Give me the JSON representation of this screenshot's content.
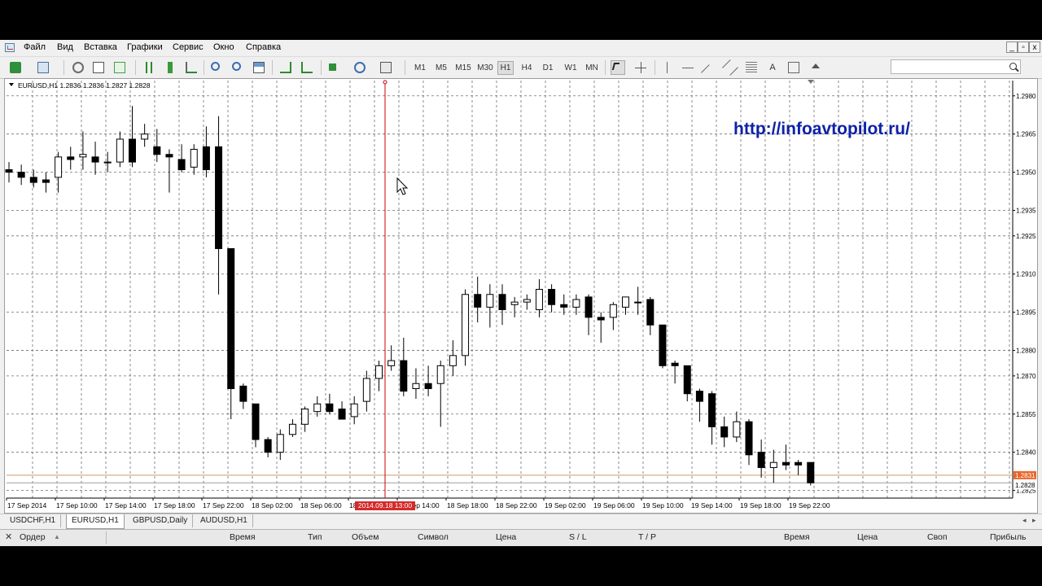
{
  "menu": {
    "items": [
      "Файл",
      "Вид",
      "Вставка",
      "Графики",
      "Сервис",
      "Окно",
      "Справка"
    ],
    "window_buttons": [
      "_",
      "▫",
      "x"
    ]
  },
  "toolbar": {
    "timeframes": [
      "M1",
      "M5",
      "M15",
      "M30",
      "H1",
      "H4",
      "D1",
      "W1",
      "MN"
    ],
    "active_timeframe": "H1",
    "search_placeholder": ""
  },
  "chart": {
    "symbol_label": "EURUSD,H1",
    "ohlc": "1.2836 1.2836 1.2827 1.2828",
    "watermark_url": "http://infoavtopilot.ru/",
    "crosshair_time_label": "2014.09.18 13:00",
    "current_price_label": "1.2831",
    "current_price_label_2": "1.2828",
    "colors": {
      "up_candle": "#ffffff",
      "down_candle": "#000000",
      "grid": "#6f6f6f",
      "watermark": "#0d21a8",
      "crosshair": "#cc0000",
      "price_line": "#d19a6a"
    }
  },
  "chart_data": {
    "type": "candlestick",
    "symbol": "EURUSD",
    "timeframe": "H1",
    "y_ticks": [
      "1.2980",
      "1.2965",
      "1.2950",
      "1.2935",
      "1.2925",
      "1.2910",
      "1.2895",
      "1.2880",
      "1.2870",
      "1.2855",
      "1.2840",
      "1.2825"
    ],
    "x_ticks": [
      "17 Sep 2014",
      "17 Sep 10:00",
      "17 Sep 14:00",
      "17 Sep 18:00",
      "17 Sep 22:00",
      "18 Sep 02:00",
      "18 Sep 06:00",
      "18 Sep 10:00",
      "18 Sep 14:00",
      "18 Sep 18:00",
      "18 Sep 22:00",
      "19 Sep 02:00",
      "19 Sep 06:00",
      "19 Sep 10:00",
      "19 Sep 14:00",
      "19 Sep 18:00",
      "19 Sep 22:00"
    ],
    "ylim": [
      1.2822,
      1.2986
    ],
    "grid": true,
    "candles": [
      {
        "o": 1.2951,
        "h": 1.2954,
        "l": 1.2946,
        "c": 1.295
      },
      {
        "o": 1.295,
        "h": 1.2953,
        "l": 1.2945,
        "c": 1.2948
      },
      {
        "o": 1.2948,
        "h": 1.2951,
        "l": 1.2944,
        "c": 1.2946
      },
      {
        "o": 1.2947,
        "h": 1.295,
        "l": 1.2942,
        "c": 1.2946
      },
      {
        "o": 1.2948,
        "h": 1.2958,
        "l": 1.2942,
        "c": 1.2956
      },
      {
        "o": 1.2956,
        "h": 1.296,
        "l": 1.2951,
        "c": 1.2955
      },
      {
        "o": 1.2956,
        "h": 1.2966,
        "l": 1.2951,
        "c": 1.2957
      },
      {
        "o": 1.2956,
        "h": 1.2962,
        "l": 1.2949,
        "c": 1.2954
      },
      {
        "o": 1.2954,
        "h": 1.2958,
        "l": 1.295,
        "c": 1.2954
      },
      {
        "o": 1.2954,
        "h": 1.2966,
        "l": 1.2952,
        "c": 1.2963
      },
      {
        "o": 1.2963,
        "h": 1.2976,
        "l": 1.2952,
        "c": 1.2954
      },
      {
        "o": 1.2963,
        "h": 1.2969,
        "l": 1.296,
        "c": 1.2965
      },
      {
        "o": 1.296,
        "h": 1.2967,
        "l": 1.2954,
        "c": 1.2957
      },
      {
        "o": 1.2957,
        "h": 1.2959,
        "l": 1.2942,
        "c": 1.2956
      },
      {
        "o": 1.2955,
        "h": 1.2961,
        "l": 1.295,
        "c": 1.2951
      },
      {
        "o": 1.2952,
        "h": 1.2961,
        "l": 1.2949,
        "c": 1.2959
      },
      {
        "o": 1.296,
        "h": 1.2968,
        "l": 1.2948,
        "c": 1.2951
      },
      {
        "o": 1.296,
        "h": 1.2972,
        "l": 1.2902,
        "c": 1.292
      },
      {
        "o": 1.292,
        "h": 1.292,
        "l": 1.2853,
        "c": 1.2865
      },
      {
        "o": 1.2866,
        "h": 1.2867,
        "l": 1.2857,
        "c": 1.286
      },
      {
        "o": 1.2859,
        "h": 1.2859,
        "l": 1.2842,
        "c": 1.2845
      },
      {
        "o": 1.2845,
        "h": 1.2846,
        "l": 1.2838,
        "c": 1.284
      },
      {
        "o": 1.284,
        "h": 1.2849,
        "l": 1.2837,
        "c": 1.2847
      },
      {
        "o": 1.2847,
        "h": 1.2853,
        "l": 1.2846,
        "c": 1.2851
      },
      {
        "o": 1.2851,
        "h": 1.2858,
        "l": 1.2848,
        "c": 1.2857
      },
      {
        "o": 1.2856,
        "h": 1.2862,
        "l": 1.2854,
        "c": 1.2859
      },
      {
        "o": 1.2859,
        "h": 1.2863,
        "l": 1.2855,
        "c": 1.2856
      },
      {
        "o": 1.2857,
        "h": 1.286,
        "l": 1.2853,
        "c": 1.2853
      },
      {
        "o": 1.2854,
        "h": 1.2862,
        "l": 1.2851,
        "c": 1.2859
      },
      {
        "o": 1.286,
        "h": 1.2872,
        "l": 1.2856,
        "c": 1.2869
      },
      {
        "o": 1.2869,
        "h": 1.2876,
        "l": 1.2864,
        "c": 1.2874
      },
      {
        "o": 1.2874,
        "h": 1.2882,
        "l": 1.2872,
        "c": 1.2876
      },
      {
        "o": 1.2876,
        "h": 1.2885,
        "l": 1.2862,
        "c": 1.2864
      },
      {
        "o": 1.2865,
        "h": 1.2873,
        "l": 1.2861,
        "c": 1.2867
      },
      {
        "o": 1.2867,
        "h": 1.2874,
        "l": 1.2862,
        "c": 1.2865
      },
      {
        "o": 1.2867,
        "h": 1.2876,
        "l": 1.285,
        "c": 1.2874
      },
      {
        "o": 1.2874,
        "h": 1.2884,
        "l": 1.287,
        "c": 1.2878
      },
      {
        "o": 1.2878,
        "h": 1.2904,
        "l": 1.2874,
        "c": 1.2902
      },
      {
        "o": 1.2902,
        "h": 1.2909,
        "l": 1.2891,
        "c": 1.2897
      },
      {
        "o": 1.2897,
        "h": 1.2906,
        "l": 1.2889,
        "c": 1.2902
      },
      {
        "o": 1.2902,
        "h": 1.2906,
        "l": 1.289,
        "c": 1.2896
      },
      {
        "o": 1.2898,
        "h": 1.2901,
        "l": 1.2893,
        "c": 1.2899
      },
      {
        "o": 1.2899,
        "h": 1.2902,
        "l": 1.2896,
        "c": 1.29
      },
      {
        "o": 1.2896,
        "h": 1.2908,
        "l": 1.2893,
        "c": 1.2904
      },
      {
        "o": 1.2904,
        "h": 1.2906,
        "l": 1.2895,
        "c": 1.2898
      },
      {
        "o": 1.2898,
        "h": 1.2902,
        "l": 1.2894,
        "c": 1.2897
      },
      {
        "o": 1.2897,
        "h": 1.2902,
        "l": 1.2894,
        "c": 1.29
      },
      {
        "o": 1.2901,
        "h": 1.2902,
        "l": 1.2886,
        "c": 1.2893
      },
      {
        "o": 1.2893,
        "h": 1.2895,
        "l": 1.2883,
        "c": 1.2892
      },
      {
        "o": 1.2893,
        "h": 1.2899,
        "l": 1.2888,
        "c": 1.2898
      },
      {
        "o": 1.2897,
        "h": 1.2901,
        "l": 1.2894,
        "c": 1.2901
      },
      {
        "o": 1.2899,
        "h": 1.2905,
        "l": 1.2894,
        "c": 1.2899
      },
      {
        "o": 1.29,
        "h": 1.2901,
        "l": 1.2886,
        "c": 1.289
      },
      {
        "o": 1.289,
        "h": 1.289,
        "l": 1.2873,
        "c": 1.2874
      },
      {
        "o": 1.2875,
        "h": 1.2876,
        "l": 1.2867,
        "c": 1.2874
      },
      {
        "o": 1.2874,
        "h": 1.2874,
        "l": 1.286,
        "c": 1.2863
      },
      {
        "o": 1.2864,
        "h": 1.2865,
        "l": 1.2852,
        "c": 1.286
      },
      {
        "o": 1.2863,
        "h": 1.2864,
        "l": 1.2843,
        "c": 1.285
      },
      {
        "o": 1.285,
        "h": 1.2854,
        "l": 1.2842,
        "c": 1.2846
      },
      {
        "o": 1.2846,
        "h": 1.2856,
        "l": 1.2844,
        "c": 1.2852
      },
      {
        "o": 1.2852,
        "h": 1.2853,
        "l": 1.2835,
        "c": 1.2839
      },
      {
        "o": 1.284,
        "h": 1.2845,
        "l": 1.283,
        "c": 1.2834
      },
      {
        "o": 1.2834,
        "h": 1.2841,
        "l": 1.2828,
        "c": 1.2836
      },
      {
        "o": 1.2836,
        "h": 1.2843,
        "l": 1.2833,
        "c": 1.2835
      },
      {
        "o": 1.2836,
        "h": 1.2837,
        "l": 1.2831,
        "c": 1.2835
      },
      {
        "o": 1.2836,
        "h": 1.2836,
        "l": 1.2827,
        "c": 1.2828
      }
    ],
    "last_price": 1.2831,
    "last_close": 1.2828
  },
  "tabs": [
    "USDCHF,H1",
    "EURUSD,H1",
    "GBPUSD,Daily",
    "AUDUSD,H1"
  ],
  "active_tab": "EURUSD,H1",
  "terminal": {
    "columns": [
      "Ордер",
      "Время",
      "Тип",
      "Объем",
      "Символ",
      "Цена",
      "S / L",
      "T / P",
      "Время",
      "Цена",
      "Своп",
      "Прибыль"
    ]
  }
}
